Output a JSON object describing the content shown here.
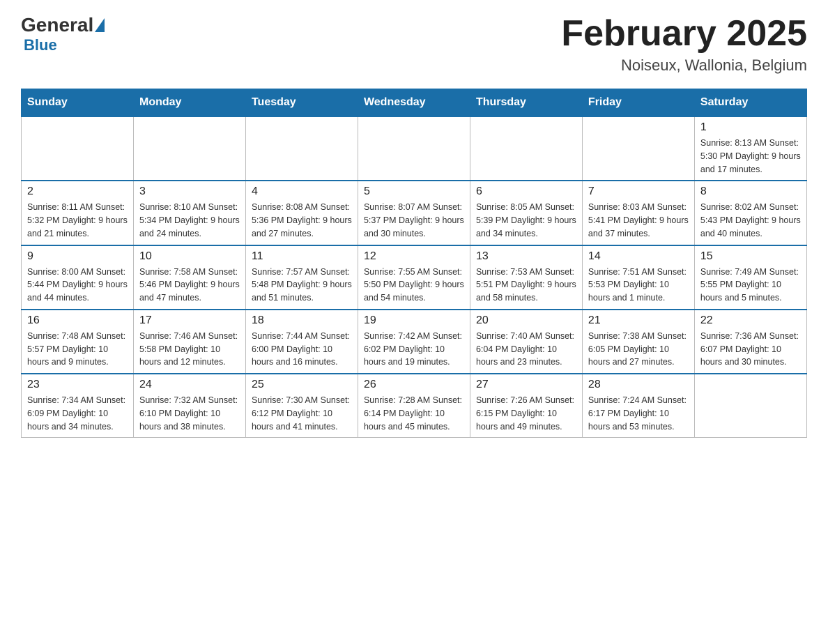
{
  "logo": {
    "general": "General",
    "blue": "Blue"
  },
  "header": {
    "month_year": "February 2025",
    "location": "Noiseux, Wallonia, Belgium"
  },
  "weekdays": [
    "Sunday",
    "Monday",
    "Tuesday",
    "Wednesday",
    "Thursday",
    "Friday",
    "Saturday"
  ],
  "weeks": [
    [
      {
        "day": "",
        "info": ""
      },
      {
        "day": "",
        "info": ""
      },
      {
        "day": "",
        "info": ""
      },
      {
        "day": "",
        "info": ""
      },
      {
        "day": "",
        "info": ""
      },
      {
        "day": "",
        "info": ""
      },
      {
        "day": "1",
        "info": "Sunrise: 8:13 AM\nSunset: 5:30 PM\nDaylight: 9 hours and 17 minutes."
      }
    ],
    [
      {
        "day": "2",
        "info": "Sunrise: 8:11 AM\nSunset: 5:32 PM\nDaylight: 9 hours and 21 minutes."
      },
      {
        "day": "3",
        "info": "Sunrise: 8:10 AM\nSunset: 5:34 PM\nDaylight: 9 hours and 24 minutes."
      },
      {
        "day": "4",
        "info": "Sunrise: 8:08 AM\nSunset: 5:36 PM\nDaylight: 9 hours and 27 minutes."
      },
      {
        "day": "5",
        "info": "Sunrise: 8:07 AM\nSunset: 5:37 PM\nDaylight: 9 hours and 30 minutes."
      },
      {
        "day": "6",
        "info": "Sunrise: 8:05 AM\nSunset: 5:39 PM\nDaylight: 9 hours and 34 minutes."
      },
      {
        "day": "7",
        "info": "Sunrise: 8:03 AM\nSunset: 5:41 PM\nDaylight: 9 hours and 37 minutes."
      },
      {
        "day": "8",
        "info": "Sunrise: 8:02 AM\nSunset: 5:43 PM\nDaylight: 9 hours and 40 minutes."
      }
    ],
    [
      {
        "day": "9",
        "info": "Sunrise: 8:00 AM\nSunset: 5:44 PM\nDaylight: 9 hours and 44 minutes."
      },
      {
        "day": "10",
        "info": "Sunrise: 7:58 AM\nSunset: 5:46 PM\nDaylight: 9 hours and 47 minutes."
      },
      {
        "day": "11",
        "info": "Sunrise: 7:57 AM\nSunset: 5:48 PM\nDaylight: 9 hours and 51 minutes."
      },
      {
        "day": "12",
        "info": "Sunrise: 7:55 AM\nSunset: 5:50 PM\nDaylight: 9 hours and 54 minutes."
      },
      {
        "day": "13",
        "info": "Sunrise: 7:53 AM\nSunset: 5:51 PM\nDaylight: 9 hours and 58 minutes."
      },
      {
        "day": "14",
        "info": "Sunrise: 7:51 AM\nSunset: 5:53 PM\nDaylight: 10 hours and 1 minute."
      },
      {
        "day": "15",
        "info": "Sunrise: 7:49 AM\nSunset: 5:55 PM\nDaylight: 10 hours and 5 minutes."
      }
    ],
    [
      {
        "day": "16",
        "info": "Sunrise: 7:48 AM\nSunset: 5:57 PM\nDaylight: 10 hours and 9 minutes."
      },
      {
        "day": "17",
        "info": "Sunrise: 7:46 AM\nSunset: 5:58 PM\nDaylight: 10 hours and 12 minutes."
      },
      {
        "day": "18",
        "info": "Sunrise: 7:44 AM\nSunset: 6:00 PM\nDaylight: 10 hours and 16 minutes."
      },
      {
        "day": "19",
        "info": "Sunrise: 7:42 AM\nSunset: 6:02 PM\nDaylight: 10 hours and 19 minutes."
      },
      {
        "day": "20",
        "info": "Sunrise: 7:40 AM\nSunset: 6:04 PM\nDaylight: 10 hours and 23 minutes."
      },
      {
        "day": "21",
        "info": "Sunrise: 7:38 AM\nSunset: 6:05 PM\nDaylight: 10 hours and 27 minutes."
      },
      {
        "day": "22",
        "info": "Sunrise: 7:36 AM\nSunset: 6:07 PM\nDaylight: 10 hours and 30 minutes."
      }
    ],
    [
      {
        "day": "23",
        "info": "Sunrise: 7:34 AM\nSunset: 6:09 PM\nDaylight: 10 hours and 34 minutes."
      },
      {
        "day": "24",
        "info": "Sunrise: 7:32 AM\nSunset: 6:10 PM\nDaylight: 10 hours and 38 minutes."
      },
      {
        "day": "25",
        "info": "Sunrise: 7:30 AM\nSunset: 6:12 PM\nDaylight: 10 hours and 41 minutes."
      },
      {
        "day": "26",
        "info": "Sunrise: 7:28 AM\nSunset: 6:14 PM\nDaylight: 10 hours and 45 minutes."
      },
      {
        "day": "27",
        "info": "Sunrise: 7:26 AM\nSunset: 6:15 PM\nDaylight: 10 hours and 49 minutes."
      },
      {
        "day": "28",
        "info": "Sunrise: 7:24 AM\nSunset: 6:17 PM\nDaylight: 10 hours and 53 minutes."
      },
      {
        "day": "",
        "info": ""
      }
    ]
  ]
}
